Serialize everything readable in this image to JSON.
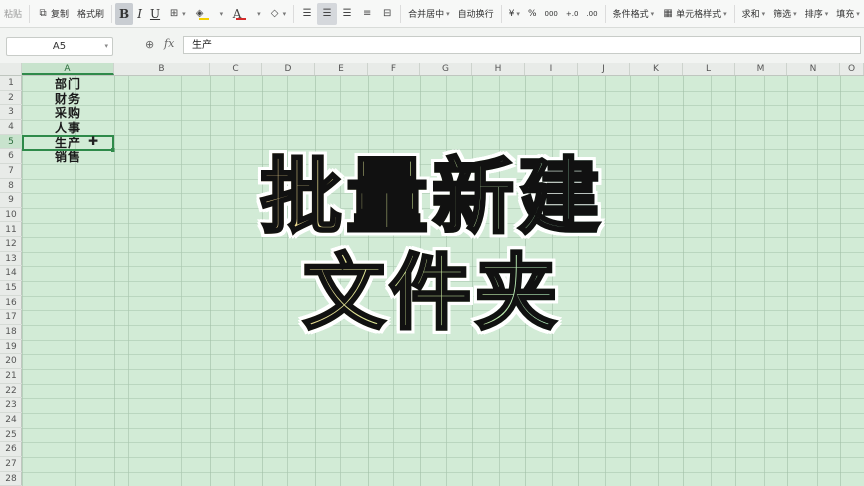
{
  "ribbon": {
    "paste_label": "粘贴",
    "copy_label": "复制",
    "format_painter_label": "格式刷",
    "bold": "B",
    "italic": "I",
    "underline": "U",
    "merge_label": "合并居中",
    "wrap_label": "自动换行",
    "currency": "¥",
    "percent": "%",
    "thousands": "000",
    "inc_decimal": "+.0",
    "dec_decimal": ".00",
    "cond_format_label": "条件格式",
    "cell_style_label": "单元格样式",
    "sum_label": "求和",
    "filter_label": "筛选",
    "sort_label": "排序",
    "fill_label": "填充",
    "font_color": "#d42a2a",
    "highlight_color": "#f5d000"
  },
  "formula_bar": {
    "name_box": "A5",
    "fx": "fx",
    "content": "生产"
  },
  "grid": {
    "columns": [
      "A",
      "B",
      "C",
      "D",
      "E",
      "F",
      "G",
      "H",
      "I",
      "J",
      "K",
      "L",
      "M",
      "N",
      "O"
    ],
    "rows": [
      "1",
      "2",
      "3",
      "4",
      "5",
      "6",
      "7",
      "8",
      "9",
      "10",
      "11",
      "12",
      "13",
      "14",
      "15",
      "16",
      "17",
      "18",
      "19",
      "20",
      "21",
      "22",
      "23",
      "24",
      "25",
      "26",
      "27",
      "28"
    ],
    "selected_cell": "A5",
    "column_a": [
      "部门",
      "财务",
      "采购",
      "人事",
      "生产",
      "销售"
    ]
  },
  "overlay": {
    "line1": "批量新建",
    "line2": "文件夹"
  }
}
